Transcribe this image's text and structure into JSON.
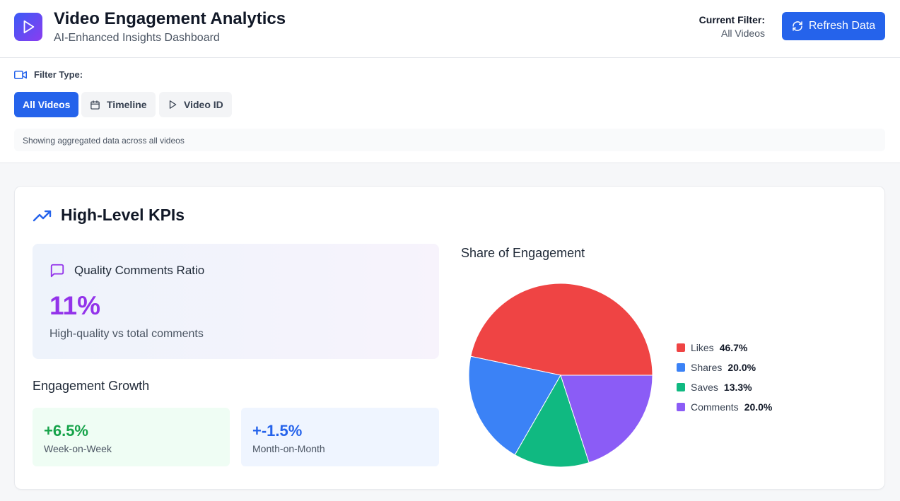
{
  "header": {
    "title": "Video Engagement Analytics",
    "subtitle": "AI-Enhanced Insights Dashboard",
    "current_filter_label": "Current Filter:",
    "current_filter_value": "All Videos",
    "refresh_label": "Refresh Data",
    "logo_icon": "play-icon",
    "logo_gradient": [
      "#3b5bf6",
      "#8b3cf0"
    ]
  },
  "filters": {
    "label": "Filter Type:",
    "options": [
      {
        "label": "All Videos",
        "active": true
      },
      {
        "label": "Timeline",
        "icon": "calendar-icon",
        "active": false
      },
      {
        "label": "Video ID",
        "icon": "play-icon",
        "active": false
      }
    ],
    "note": "Showing aggregated data across all videos"
  },
  "kpis": {
    "title": "High-Level KPIs",
    "quality": {
      "title": "Quality Comments Ratio",
      "value": "11%",
      "description": "High-quality vs total comments"
    },
    "growth": {
      "title": "Engagement Growth",
      "week": {
        "value": "+6.5%",
        "label": "Week-on-Week"
      },
      "month": {
        "value": "+-1.5%",
        "label": "Month-on-Month"
      }
    }
  },
  "chart_data": {
    "type": "pie",
    "title": "Share of Engagement",
    "slices": [
      {
        "label": "Likes",
        "value": 46.7,
        "display": "46.7%",
        "color": "#ef4444"
      },
      {
        "label": "Shares",
        "value": 20.0,
        "display": "20.0%",
        "color": "#3b82f6"
      },
      {
        "label": "Saves",
        "value": 13.3,
        "display": "13.3%",
        "color": "#10b981"
      },
      {
        "label": "Comments",
        "value": 20.0,
        "display": "20.0%",
        "color": "#8b5cf6"
      }
    ],
    "legend_position": "right"
  },
  "colors": {
    "primary": "#2563eb",
    "quality_value": "#9333ea",
    "growth_positive": "#16a34a",
    "growth_month": "#2563eb"
  }
}
